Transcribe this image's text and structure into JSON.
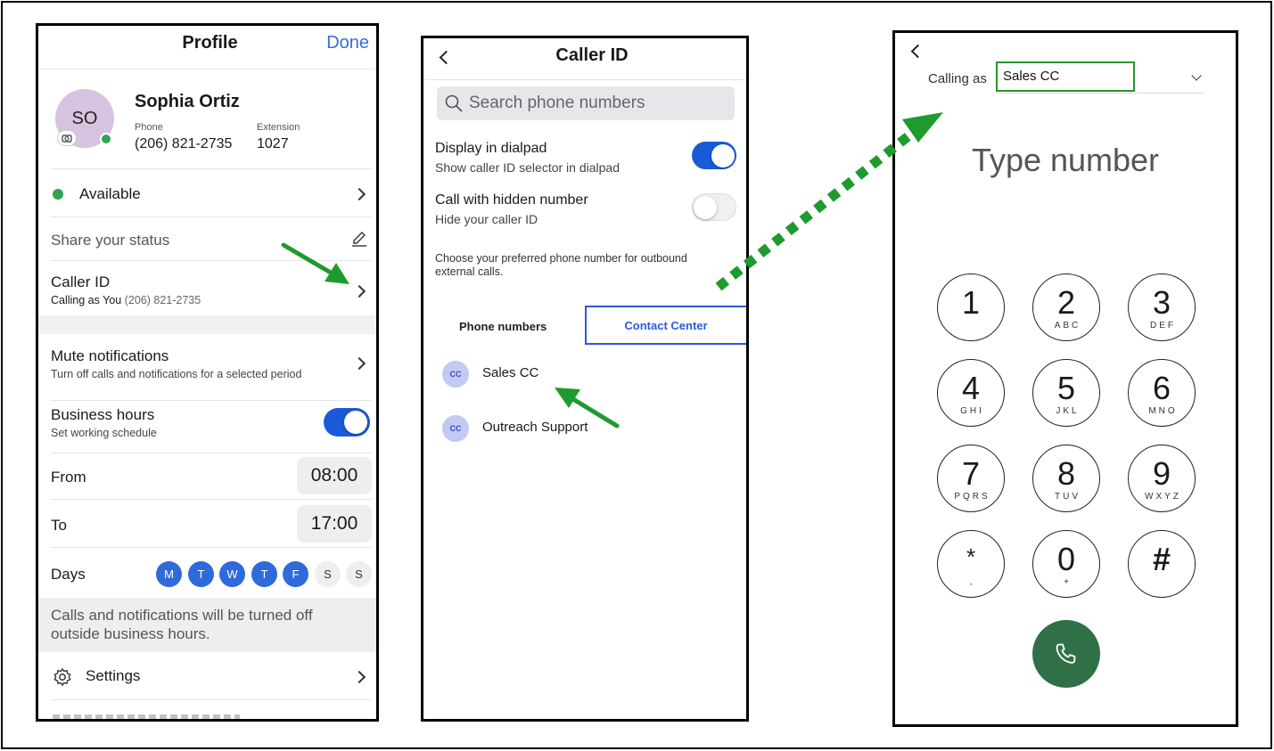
{
  "profile": {
    "title": "Profile",
    "done": "Done",
    "avatar_initials": "SO",
    "name": "Sophia Ortiz",
    "phone_label": "Phone",
    "phone": "(206) 821-2735",
    "extension_label": "Extension",
    "extension": "1027",
    "status": "Available",
    "share_status": "Share your status",
    "caller_id": {
      "title": "Caller ID",
      "prefix": "Calling as You",
      "number": "(206) 821-2735"
    },
    "mute": {
      "title": "Mute notifications",
      "subtitle": "Turn off calls and notifications for a selected period"
    },
    "business_hours": {
      "title": "Business hours",
      "subtitle": "Set working schedule",
      "enabled": true
    },
    "from_label": "From",
    "from_value": "08:00",
    "to_label": "To",
    "to_value": "17:00",
    "days_label": "Days",
    "days": [
      {
        "label": "M",
        "active": true
      },
      {
        "label": "T",
        "active": true
      },
      {
        "label": "W",
        "active": true
      },
      {
        "label": "T",
        "active": true
      },
      {
        "label": "F",
        "active": true
      },
      {
        "label": "S",
        "active": false
      },
      {
        "label": "S",
        "active": false
      }
    ],
    "note": "Calls and notifications will be turned off outside business hours.",
    "settings": "Settings"
  },
  "caller": {
    "title": "Caller ID",
    "search_placeholder": "Search phone numbers",
    "display_dialpad": {
      "title": "Display in dialpad",
      "subtitle": "Show caller ID selector in dialpad",
      "enabled": true
    },
    "hidden_number": {
      "title": "Call with hidden number",
      "subtitle": "Hide your caller ID",
      "enabled": false
    },
    "description": "Choose your preferred phone number for outbound external calls.",
    "tabs": [
      "Phone numbers",
      "Contact Center"
    ],
    "items": [
      {
        "avatar": "CC",
        "label": "Sales CC"
      },
      {
        "avatar": "CC",
        "label": "Outreach Support"
      }
    ]
  },
  "dialer": {
    "calling_as_label": "Calling as",
    "calling_as_value": "Sales CC",
    "placeholder": "Type number",
    "keys": [
      {
        "digit": "1",
        "letters": ""
      },
      {
        "digit": "2",
        "letters": "ABC"
      },
      {
        "digit": "3",
        "letters": "DEF"
      },
      {
        "digit": "4",
        "letters": "GHI"
      },
      {
        "digit": "5",
        "letters": "JKL"
      },
      {
        "digit": "6",
        "letters": "MNO"
      },
      {
        "digit": "7",
        "letters": "PQRS"
      },
      {
        "digit": "8",
        "letters": "TUV"
      },
      {
        "digit": "9",
        "letters": "WXYZ"
      },
      {
        "digit": "*",
        "letters": ","
      },
      {
        "digit": "0",
        "letters": "+"
      },
      {
        "digit": "#",
        "letters": ""
      }
    ]
  },
  "colors": {
    "accent_blue": "#2f6fde",
    "toggle_blue": "#1a5ad8",
    "day_blue": "#2e6ad9",
    "call_green": "#2f7047",
    "annotation_green": "#1f9a2f",
    "status_green": "#2ea44f"
  }
}
